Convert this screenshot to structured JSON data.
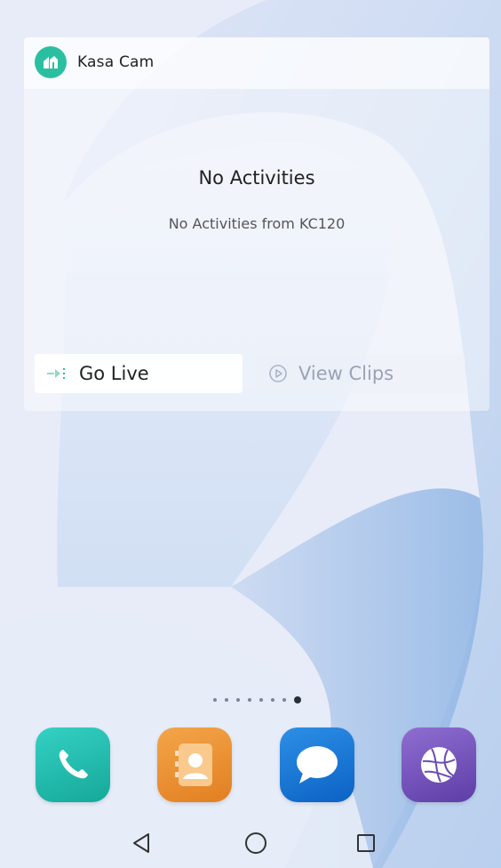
{
  "widget": {
    "app_name": "Kasa Cam",
    "app_icon": "kasa-logo-icon",
    "empty_title": "No Activities",
    "empty_subtitle": "No Activities from KC120",
    "go_live_label": "Go Live",
    "go_live_icon": "live-stream-icon",
    "view_clips_label": "View Clips",
    "view_clips_icon": "play-circle-icon",
    "accent_color": "#2bbfa2"
  },
  "home_screen": {
    "page_count": 8,
    "active_page": 8
  },
  "dock": [
    {
      "name": "Phone",
      "icon": "phone-icon"
    },
    {
      "name": "Contacts",
      "icon": "contacts-icon"
    },
    {
      "name": "Messages",
      "icon": "message-bubble-icon"
    },
    {
      "name": "Browser",
      "icon": "globe-icon"
    }
  ],
  "navbar": {
    "back_icon": "back-triangle-icon",
    "home_icon": "home-circle-icon",
    "recents_icon": "recents-square-icon"
  }
}
